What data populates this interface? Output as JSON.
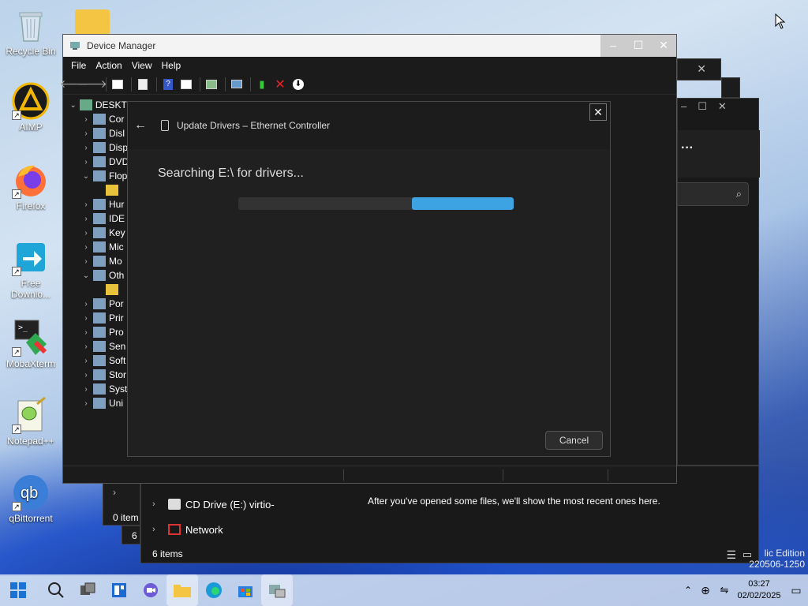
{
  "desktop": {
    "icons": [
      {
        "label": "Recycle Bin"
      },
      {
        "label": "AIMP"
      },
      {
        "label": "Firefox"
      },
      {
        "label": "Free Downlo..."
      },
      {
        "label": "MobaXterm"
      },
      {
        "label": "Notepad++"
      },
      {
        "label": "qBittorrent"
      }
    ],
    "watermark_line1": "lic Edition",
    "watermark_line2": "220506-1250"
  },
  "device_manager": {
    "title": "Device Manager",
    "menu": [
      "File",
      "Action",
      "View",
      "Help"
    ],
    "tree_root": "DESKTO",
    "tree_items": [
      "Cor",
      "Disl",
      "Disp",
      "DVD",
      "Flop",
      "",
      "Hur",
      "IDE",
      "Key",
      "Mic",
      "Mo",
      "Oth",
      "",
      "Por",
      "Prir",
      "Pro",
      "Sen",
      "Soft",
      "Stor",
      "Syst",
      "Uni"
    ]
  },
  "update_dialog": {
    "title": "Update Drivers – Ethernet Controller",
    "status": "Searching E:\\ for drivers...",
    "cancel_label": "Cancel",
    "progress_start": 0.63,
    "progress_end": 1.0
  },
  "explorer": {
    "rows": [
      {
        "label": "CD Drive (E:) virtio-"
      },
      {
        "label": "Network"
      }
    ],
    "status": "6 items",
    "empty_recent": "After you've opened some files, we'll show the most recent ones here.",
    "left_partial": "0 item",
    "left_partial2": "6"
  },
  "taskbar": {
    "time": "03:27",
    "date": "02/02/2025"
  }
}
